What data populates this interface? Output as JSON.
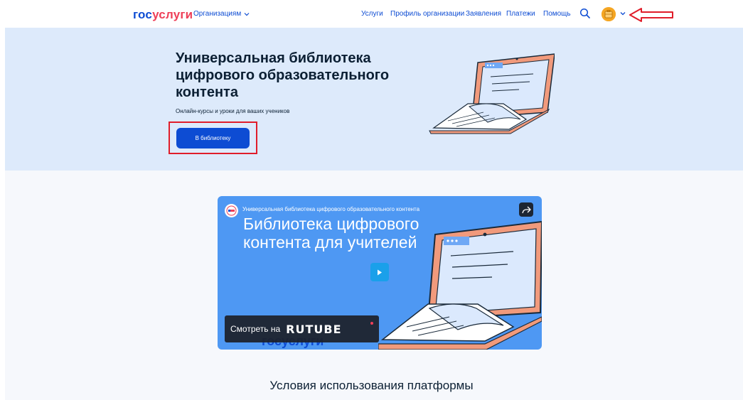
{
  "header": {
    "logo_part1": "гос",
    "logo_part2": "услуги",
    "org_menu_label": "Организациям",
    "nav": [
      "Услуги",
      "Профиль организации",
      "Заявления",
      "Платежи",
      "Помощь"
    ],
    "icons": {
      "search": "search-icon",
      "avatar": "avatar",
      "chevron": "chevron-down-icon"
    }
  },
  "hero": {
    "title": "Универсальная библиотека цифрового образовательного контента",
    "subtitle": "Онлайн-курсы и уроки для ваших учеников",
    "button_label": "В библиотеку"
  },
  "video": {
    "top_title": "Универсальная библиотека цифрового образовательного контента",
    "big_text": "Библиотека цифрового контента для учителей",
    "watch_label": "Смотреть на",
    "watch_brand": "RUTUBE",
    "footer_logo": "госуслуги"
  },
  "terms": {
    "title": "Условия использования платформы"
  },
  "colors": {
    "brand_blue": "#0d4cd3",
    "brand_red": "#ee3f58",
    "hero_bg": "#ddeafb",
    "video_bg": "#4e98f3",
    "annotation_red": "#e01d2a"
  }
}
